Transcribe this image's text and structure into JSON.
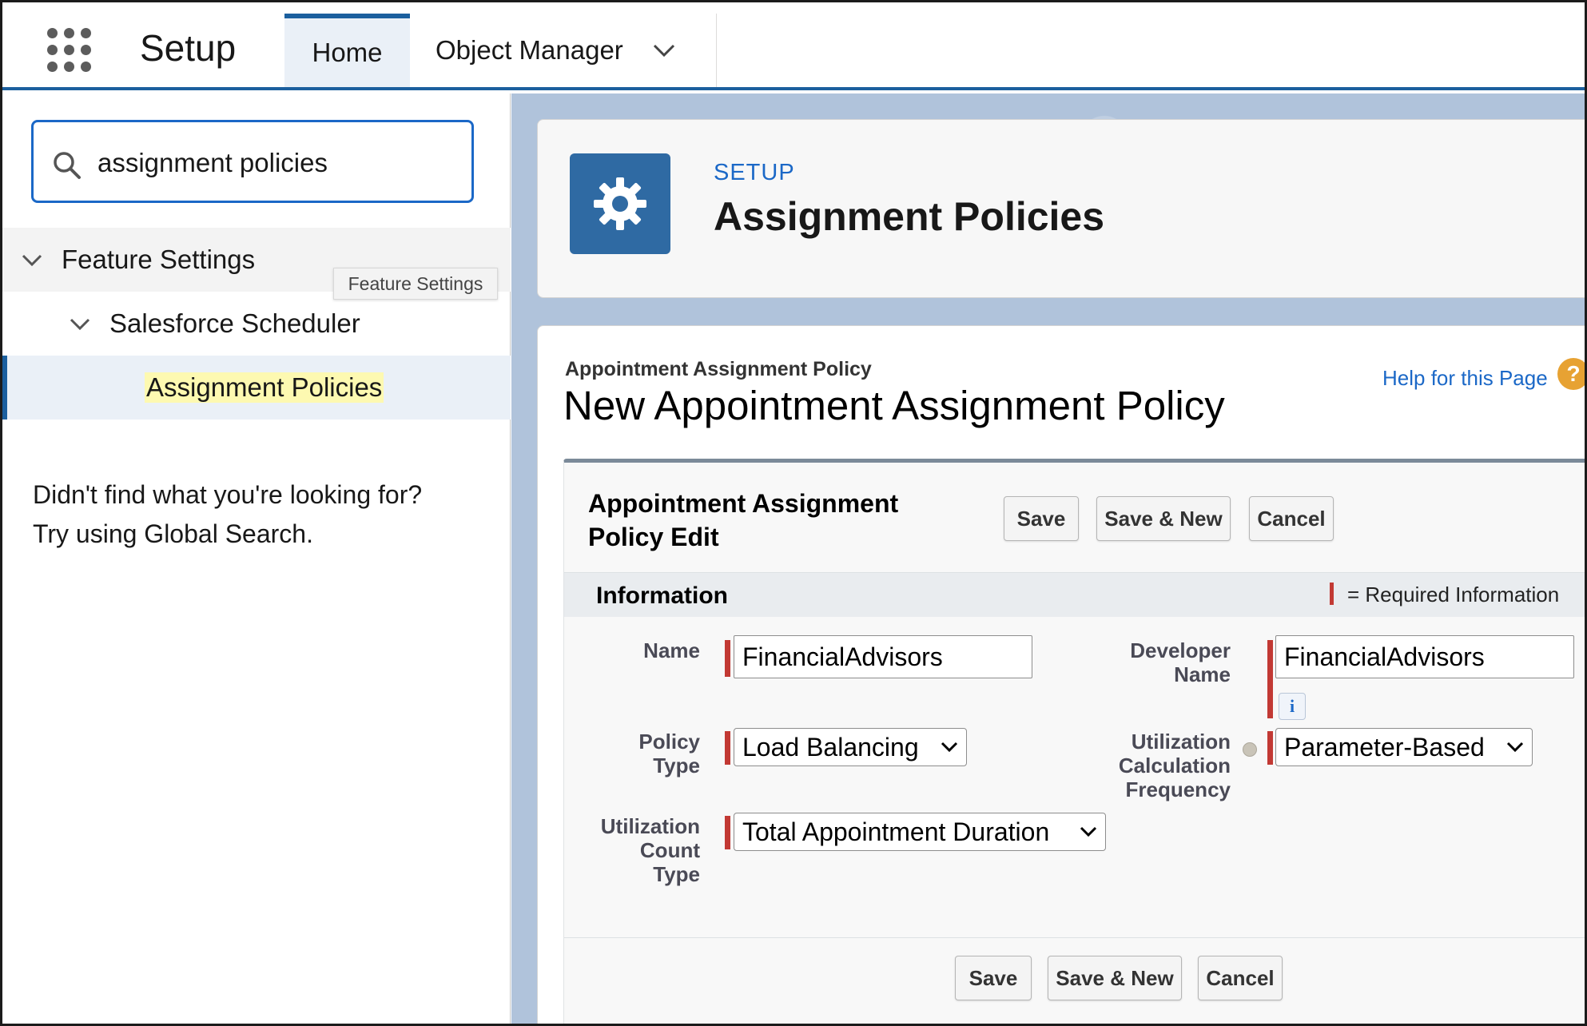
{
  "nav": {
    "app_title": "Setup",
    "tabs": [
      {
        "label": "Home",
        "active": true
      },
      {
        "label": "Object Manager",
        "has_dropdown": true
      }
    ],
    "accent_color": "#1b5f9e"
  },
  "sidebar": {
    "search": {
      "value": "assignment policies",
      "placeholder": "Quick Find"
    },
    "tree": [
      {
        "label": "Feature Settings",
        "expanded": true,
        "level": 1
      },
      {
        "label": "Salesforce Scheduler",
        "expanded": true,
        "level": 2
      },
      {
        "label": "Assignment Policies",
        "selected": true,
        "level": 3
      }
    ],
    "tooltip": "Feature Settings",
    "not_found_line1": "Didn't find what you're looking for?",
    "not_found_line2": "Try using Global Search."
  },
  "header": {
    "eyebrow": "SETUP",
    "title": "Assignment Policies",
    "icon": "gear-icon",
    "icon_color": "#2f6aa3"
  },
  "page": {
    "object_label": "Appointment Assignment Policy",
    "title": "New Appointment Assignment Policy",
    "help_link": "Help for this Page",
    "help_icon_glyph": "?"
  },
  "edit": {
    "title": "Appointment Assignment Policy Edit",
    "buttons": {
      "save": "Save",
      "save_new": "Save & New",
      "cancel": "Cancel"
    },
    "section_title": "Information",
    "required_text": "= Required Information",
    "required_color": "#c23934",
    "fields": {
      "name": {
        "label": "Name",
        "value": "FinancialAdvisors"
      },
      "developer_name": {
        "label_line1": "Developer",
        "label_line2": "Name",
        "value": "FinancialAdvisors"
      },
      "policy_type": {
        "label_line1": "Policy",
        "label_line2": "Type",
        "value": "Load Balancing"
      },
      "utilization_frequency": {
        "label_line1": "Utilization",
        "label_line2": "Calculation",
        "label_line3": "Frequency",
        "value": "Parameter-Based"
      },
      "utilization_count_type": {
        "label_line1": "Utilization",
        "label_line2": "Count",
        "label_line3": "Type",
        "value": "Total Appointment Duration"
      }
    },
    "info_icon_glyph": "i"
  }
}
